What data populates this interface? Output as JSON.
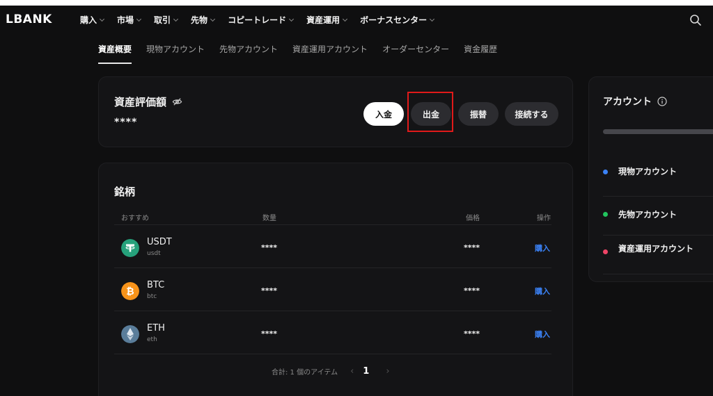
{
  "brand": {
    "logo": "LBANK"
  },
  "nav": {
    "items": [
      {
        "label": "購入"
      },
      {
        "label": "市場"
      },
      {
        "label": "取引"
      },
      {
        "label": "先物"
      },
      {
        "label": "コピートレード"
      },
      {
        "label": "資産運用"
      },
      {
        "label": "ボーナスセンター"
      }
    ],
    "search_icon": "search-icon"
  },
  "subtabs": [
    {
      "label": "資産概要",
      "active": true
    },
    {
      "label": "現物アカウント"
    },
    {
      "label": "先物アカウント"
    },
    {
      "label": "資産運用アカウント"
    },
    {
      "label": "オーダーセンター"
    },
    {
      "label": "資金履歴"
    }
  ],
  "valuation": {
    "title": "資産評価額",
    "amount": "****",
    "buttons": {
      "deposit": "入金",
      "withdraw": "出金",
      "transfer": "振替",
      "connect": "接続する"
    },
    "highlight_color": "#e11a1a"
  },
  "holdings": {
    "title": "銘柄",
    "columns": {
      "recommended": "おすすめ",
      "quantity": "数量",
      "price": "価格",
      "action": "操作"
    },
    "rows": [
      {
        "symbol": "USDT",
        "sub": "usdt",
        "quantity": "****",
        "price": "****",
        "action": "購入",
        "icon": "tether-icon",
        "color": "#26a17b"
      },
      {
        "symbol": "BTC",
        "sub": "btc",
        "quantity": "****",
        "price": "****",
        "action": "購入",
        "icon": "bitcoin-icon",
        "color": "#f7931a"
      },
      {
        "symbol": "ETH",
        "sub": "eth",
        "quantity": "****",
        "price": "****",
        "action": "購入",
        "icon": "ethereum-icon",
        "color": "#5a7d9a"
      }
    ],
    "pagination": {
      "total": "合計: 1 個のアイテム",
      "page": "1"
    }
  },
  "accounts": {
    "title": "アカウント",
    "items": [
      {
        "label": "現物アカウント",
        "color": "#3b82f6"
      },
      {
        "label": "先物アカウント",
        "color": "#22c55e"
      },
      {
        "label": "資産運用アカウント",
        "color": "#ef4466"
      }
    ]
  },
  "colors": {
    "background": "#0f0f10",
    "card": "#141416",
    "accent_link": "#3b82f6"
  }
}
